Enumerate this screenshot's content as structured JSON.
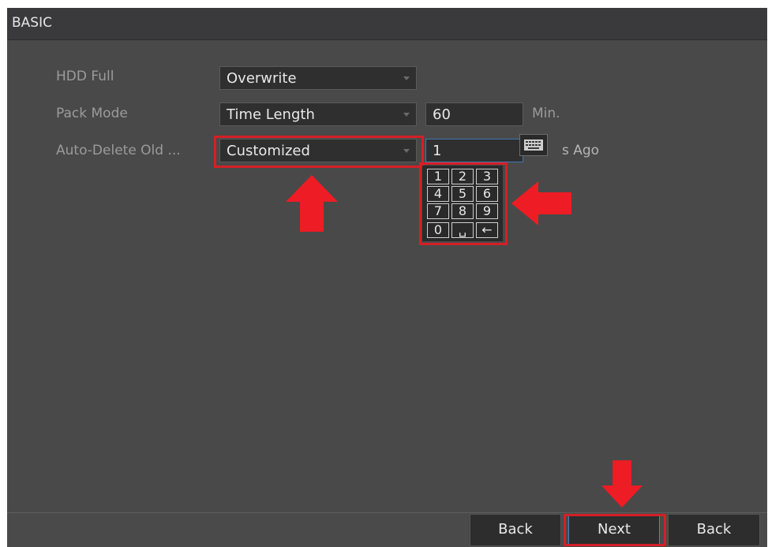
{
  "window": {
    "title": "BASIC"
  },
  "fields": {
    "hdd_full": {
      "label": "HDD Full",
      "value": "Overwrite"
    },
    "pack_mode": {
      "label": "Pack Mode",
      "value": "Time Length",
      "number": "60",
      "unit": "Min."
    },
    "auto_delete": {
      "label": "Auto-Delete Old ...",
      "value": "Customized",
      "number": "1",
      "unit": "s Ago"
    }
  },
  "numpad": {
    "keys": [
      "1",
      "2",
      "3",
      "4",
      "5",
      "6",
      "7",
      "8",
      "9",
      "0",
      "␣",
      "←"
    ]
  },
  "footer": {
    "back_label": "Back",
    "next_label": "Next",
    "back2_label": "Back"
  },
  "colors": {
    "highlight": "#d51f26",
    "focus": "#3f78b8",
    "arrow": "#ee1c24"
  },
  "icons": {
    "keyboard": "keyboard-icon",
    "dropdown": "chevron-down-icon",
    "annotation_arrow": "red-arrow"
  }
}
